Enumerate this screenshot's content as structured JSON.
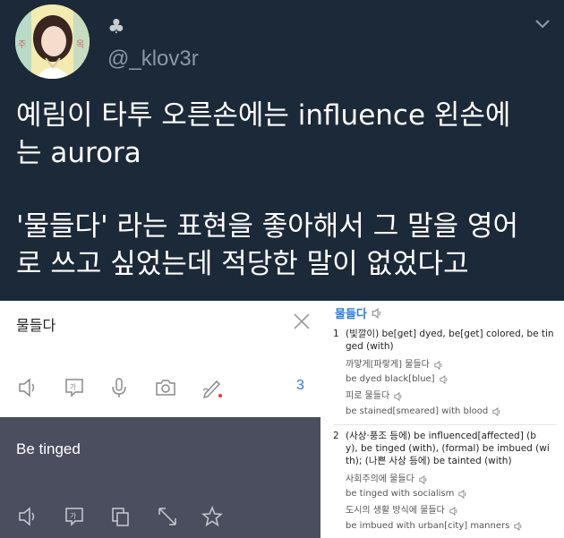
{
  "tweet": {
    "club_symbol": "♣",
    "handle": "@_klov3r",
    "lines": [
      "예림이 타투 오른손에는 influence 왼손에",
      "는 aurora",
      "'물들다' 라는 표현을 좋아해서 그 말을 영어",
      "로 쓰고 싶었는데 적당한 말이 없었다고"
    ]
  },
  "translator": {
    "source_text": "물들다",
    "count": "3",
    "target_text": "Be tinged",
    "source_tools": [
      "speaker-icon",
      "handwriting-icon",
      "microphone-icon",
      "camera-icon",
      "pen-icon"
    ],
    "target_tools": [
      "speaker-icon",
      "handwriting-icon",
      "copy-icon",
      "expand-icon",
      "star-icon"
    ]
  },
  "dictionary": {
    "headword": "물들다",
    "senses": [
      {
        "num": "1",
        "definition_lines": [
          "(빛깔이) be[get] dyed, be[get] colored, be tin",
          "ged (with)"
        ],
        "examples": [
          {
            "ko": "까맣게[파랗게] 물들다",
            "en": "be dyed black[blue]"
          },
          {
            "ko": "피로 물들다",
            "en": "be stained[smeared] with blood"
          }
        ]
      },
      {
        "num": "2",
        "definition_lines": [
          "(사상·풍조 등에) be influenced[affected] (b",
          "y), be tinged (with), (formal) be imbued (wi",
          "th); (나쁜 사상 등에) be tainted (with)"
        ],
        "examples": [
          {
            "ko": "사회주의에 물들다",
            "en": "be tinged with socialism"
          },
          {
            "ko": "도시의 생활 방식에 물들다",
            "en": "be imbued with urban[city] manners"
          }
        ]
      }
    ]
  },
  "colors": {
    "tweet_bg": "#1c2938",
    "handle": "#8899a6",
    "accent_blue": "#2a7ae2",
    "target_pane_bg": "#4a4e5e",
    "recording_dot": "#e53935"
  }
}
